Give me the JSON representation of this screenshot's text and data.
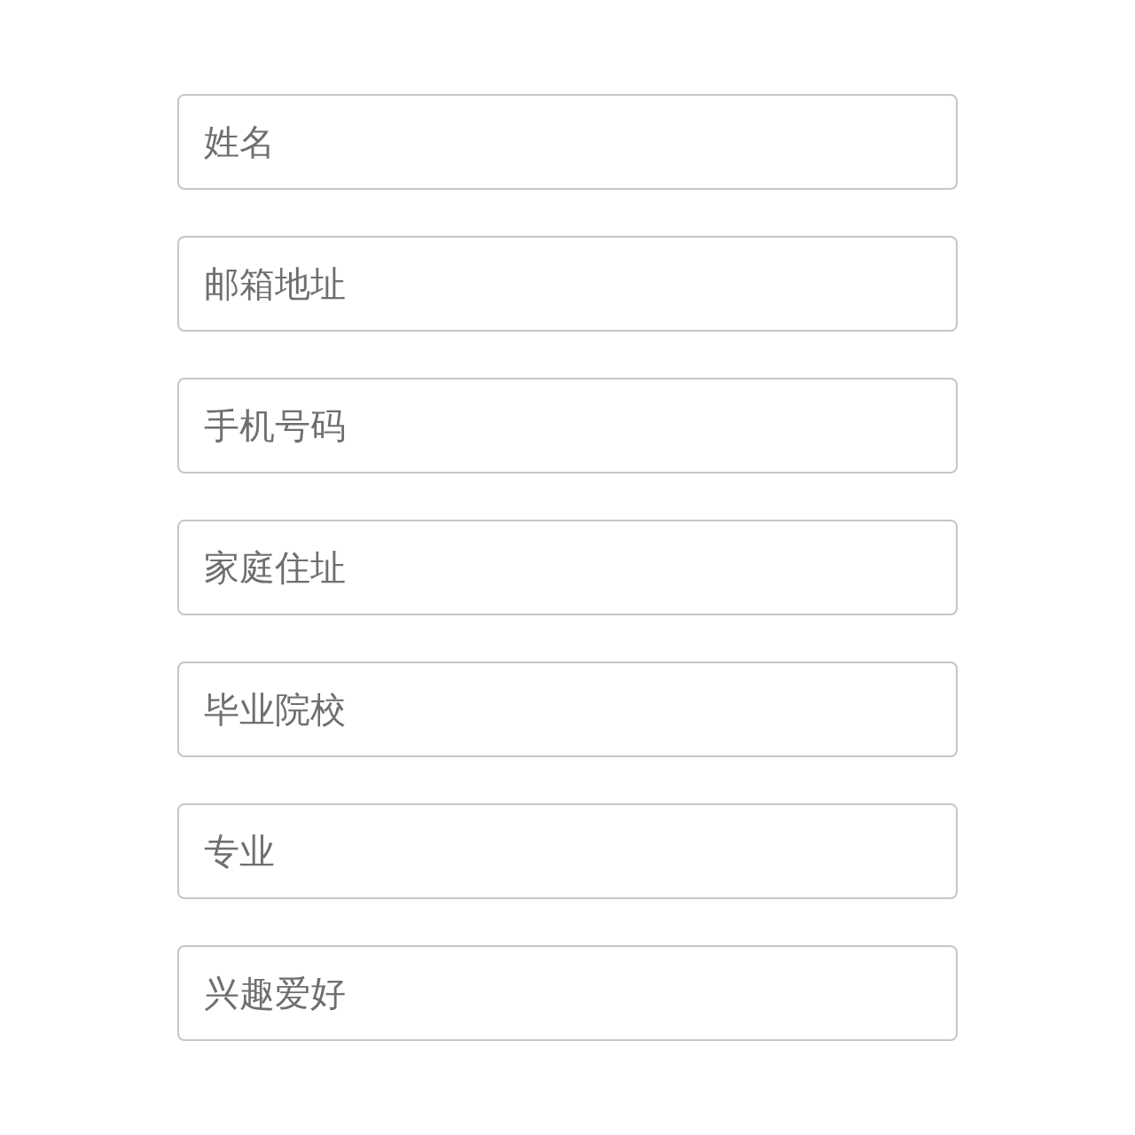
{
  "fields": [
    {
      "placeholder": "姓名"
    },
    {
      "placeholder": "邮箱地址"
    },
    {
      "placeholder": "手机号码"
    },
    {
      "placeholder": "家庭住址"
    },
    {
      "placeholder": "毕业院校"
    },
    {
      "placeholder": "专业"
    },
    {
      "placeholder": "兴趣爱好"
    }
  ]
}
